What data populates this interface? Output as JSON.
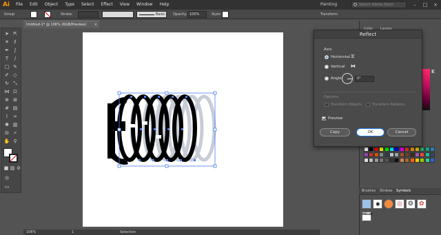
{
  "app": {
    "logo": "Ai",
    "menu": [
      "File",
      "Edit",
      "Object",
      "Type",
      "Select",
      "Effect",
      "View",
      "Window",
      "Help"
    ],
    "workspace": "Painting",
    "search_placeholder": "Search Adobe Stock"
  },
  "control_bar": {
    "selection_label": "Group",
    "stroke_label": "Stroke:",
    "brush_label": "Basic",
    "opacity_label": "Opacity:",
    "opacity_value": "100%",
    "style_label": "Style:",
    "transform_label": "Transform"
  },
  "document": {
    "tab_title": "Untitled-1* @ 106% (RGB/Preview)",
    "close": "×"
  },
  "status_bar": {
    "zoom": "106%",
    "page": "1",
    "tool": "Selection"
  },
  "dialog": {
    "title": "Reflect",
    "axis_label": "Axis",
    "horizontal_label": "Horizontal",
    "vertical_label": "Vertical",
    "angle_label": "Angle:",
    "angle_value": "0°",
    "options_label": "Options",
    "transform_objects_label": "Transform Objects",
    "transform_patterns_label": "Transform Patterns",
    "preview_label": "Preview",
    "copy_button": "Copy",
    "ok_button": "OK",
    "cancel_button": "Cancel",
    "horizontal_selected": true,
    "preview_checked": true
  },
  "panels": {
    "color_tab": "Color",
    "layers_tab": "Layers",
    "bottom_tabs": [
      "Brushes",
      "Strokes",
      "Symbols"
    ],
    "active_bottom_tab": "Symbols",
    "symbol_text": "HELLO"
  },
  "colors": {
    "accent": "#1a73e8",
    "logo": "#ff9a00",
    "artwork_black": "#000000",
    "artwork_preview": "#c8ccd6",
    "selection": "#4a7df0"
  }
}
